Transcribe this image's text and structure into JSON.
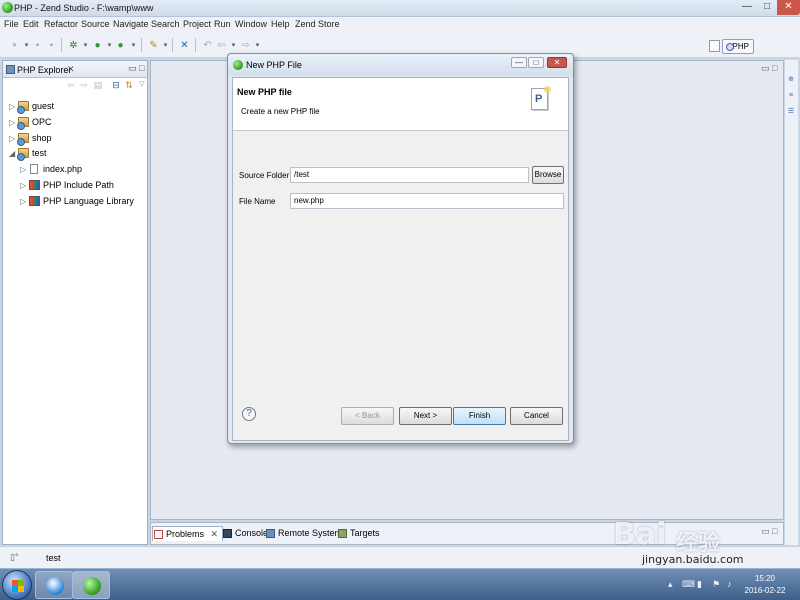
{
  "window": {
    "title": "PHP - Zend Studio - F:\\wamp\\www",
    "min": "—",
    "max": "□",
    "close": "✕"
  },
  "menu": [
    "File",
    "Edit",
    "Refactor",
    "Source",
    "Navigate",
    "Search",
    "Project",
    "Run",
    "Window",
    "Help",
    "Zend Store"
  ],
  "perspective": {
    "label": "PHP"
  },
  "explorer": {
    "title": "PHP Explorer",
    "close": "✕",
    "tree": [
      {
        "label": "guest",
        "arrow": "▷",
        "icon": "project-icon"
      },
      {
        "label": "OPC",
        "arrow": "▷",
        "icon": "project-icon"
      },
      {
        "label": "shop",
        "arrow": "▷",
        "icon": "project-icon"
      },
      {
        "label": "test",
        "arrow": "◢",
        "icon": "project-icon"
      },
      {
        "label": "index.php",
        "arrow": "▷",
        "icon": "php-file-icon"
      },
      {
        "label": "PHP Include Path",
        "arrow": "▷",
        "icon": "library-icon"
      },
      {
        "label": "PHP Language Library",
        "arrow": "▷",
        "icon": "library-icon"
      }
    ]
  },
  "bottom_tabs": [
    "Problems",
    "Console",
    "Remote Systems",
    "Targets"
  ],
  "status": {
    "text": "test"
  },
  "dialog": {
    "title": "New PHP File",
    "heading": "New PHP file",
    "description": "Create a new PHP file",
    "banner_glyph": "P",
    "source_folder_label": "Source Folder",
    "source_folder_value": "/test",
    "file_name_label": "File Name",
    "file_name_value": "new.php",
    "browse_label": "Browse",
    "help_glyph": "?",
    "buttons": {
      "back": "< Back",
      "next": "Next >",
      "finish": "Finish",
      "cancel": "Cancel"
    }
  },
  "taskbar": {
    "time": "15:20",
    "date": "2016-02-22"
  },
  "watermark": {
    "brand": "Bai",
    "brand2": "经验",
    "url": "jingyan.baidu.com"
  }
}
